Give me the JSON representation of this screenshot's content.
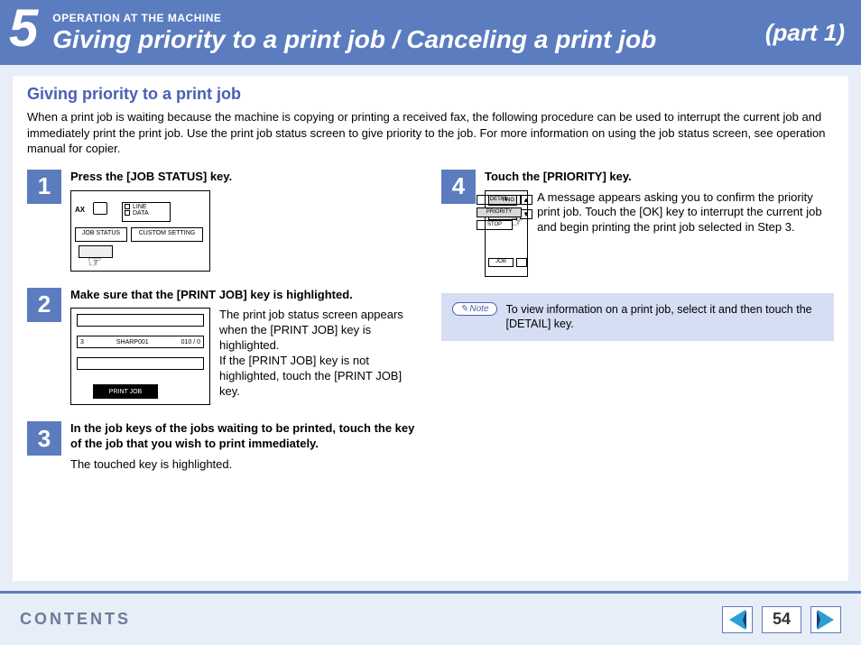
{
  "header": {
    "chapter_number": "5",
    "chapter_label": "OPERATION AT THE MACHINE",
    "title": "Giving priority to a print job / Canceling a print job",
    "part": "(part 1)"
  },
  "section_heading": "Giving priority to a print job",
  "intro": "When a print job is waiting because the machine is copying or printing a received fax, the following procedure can be used to interrupt the current job and immediately print the print job. Use the print job status screen to give priority to the job. For more information on using the job status screen, see operation manual for copier.",
  "steps": {
    "s1": {
      "num": "1",
      "title": "Press the [JOB STATUS] key.",
      "diagram": {
        "ax": "AX",
        "line": "LINE",
        "data": "DATA",
        "job_status": "JOB STATUS",
        "custom_setting": "CUSTOM SETTING"
      }
    },
    "s2": {
      "num": "2",
      "title": "Make sure that the [PRINT JOB] key is highlighted.",
      "desc": "The print job status screen appears when the [PRINT JOB] key is highlighted.\nIf the [PRINT JOB] key is not highlighted, touch the [PRINT JOB] key.",
      "diagram": {
        "row_num": "3",
        "row_name": "SHARP001",
        "row_pages": "010 / 0",
        "tab": "PRINT JOB"
      }
    },
    "s3": {
      "num": "3",
      "title": "In the job keys of the jobs waiting to be printed, touch the key of the job that you wish to print immediately.",
      "desc": "The touched key is highlighted."
    },
    "s4": {
      "num": "4",
      "title": "Touch the [PRIORITY] key.",
      "desc": "A message appears asking you to confirm the priority print job. Touch the [OK] key to interrupt the current job and begin printing the print job selected in Step 3.",
      "diagram": {
        "ting1": "TING",
        "ting2": "TING",
        "detail": "DETAIL",
        "priority": "PRIORITY",
        "stop": "STOP",
        "job": "JOB"
      }
    }
  },
  "note": {
    "badge": "Note",
    "text": "To view information on a print job, select it and then touch the [DETAIL] key."
  },
  "footer": {
    "contents": "CONTENTS",
    "page_number": "54"
  }
}
